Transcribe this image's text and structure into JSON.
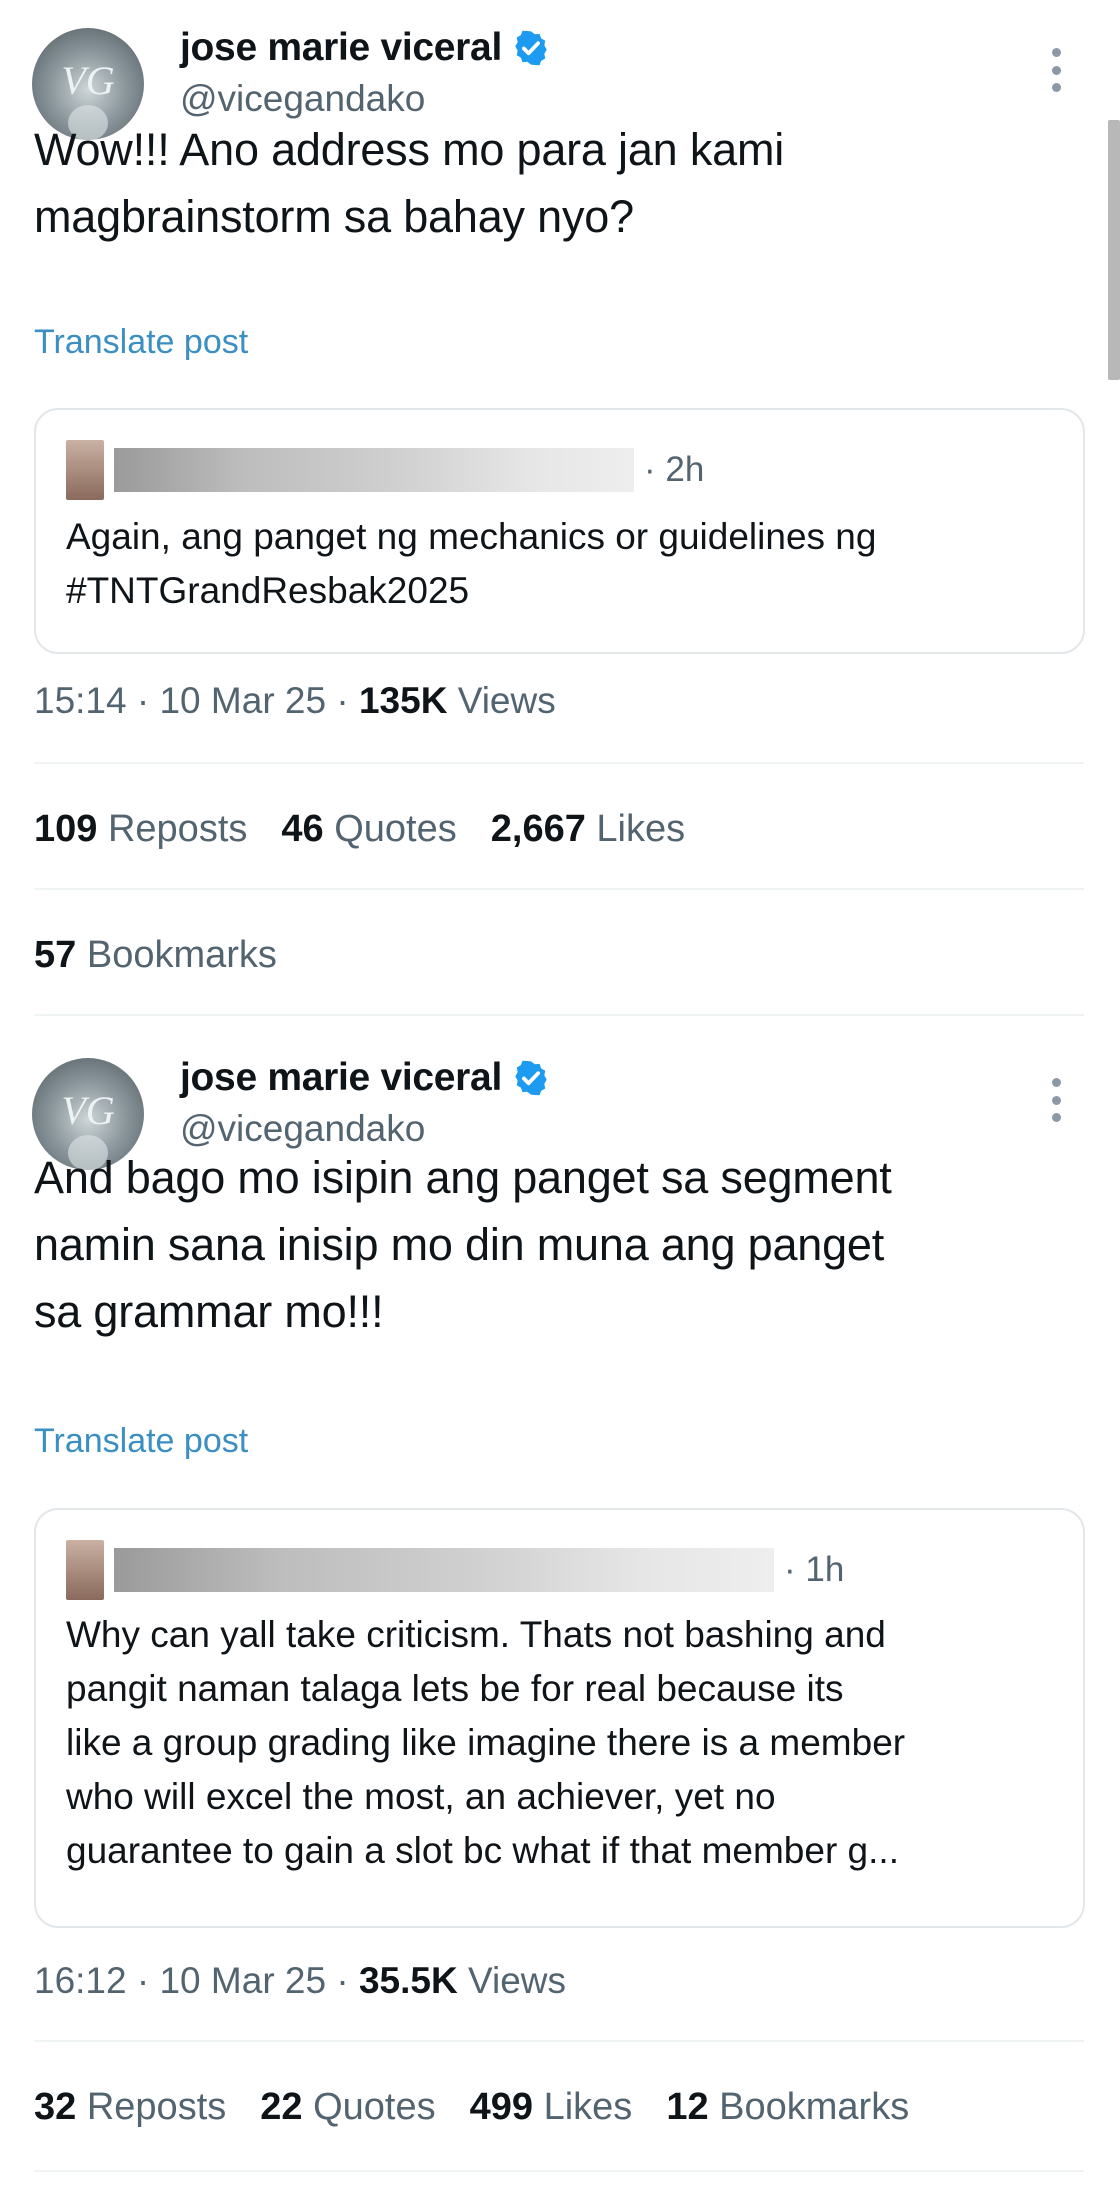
{
  "tweets": [
    {
      "display_name": "jose marie viceral",
      "handle": "@vicegandako",
      "body_lines": [
        "Wow!!! Ano address mo para jan kami",
        "magbrainstorm sa bahay nyo?"
      ],
      "translate_label": "Translate post",
      "quote": {
        "time": "· 2h",
        "text_lines": [
          "Again, ang panget ng mechanics or guidelines ng",
          "#TNTGrandResbak2025"
        ]
      },
      "meta": {
        "time": "15:14",
        "date": "10 Mar 25",
        "views_count": "135K",
        "views_label": "Views"
      },
      "stats": [
        {
          "count": "109",
          "label": "Reposts"
        },
        {
          "count": "46",
          "label": "Quotes"
        },
        {
          "count": "2,667",
          "label": "Likes"
        }
      ],
      "bookmarks": {
        "count": "57",
        "label": "Bookmarks"
      }
    },
    {
      "display_name": "jose marie viceral",
      "handle": "@vicegandako",
      "body_lines": [
        "And bago mo isipin ang panget sa segment",
        "namin sana inisip mo din muna ang panget",
        "sa grammar mo!!!"
      ],
      "translate_label": "Translate post",
      "quote": {
        "time": "· 1h",
        "text_lines": [
          "Why can yall take criticism. Thats not bashing and",
          "pangit naman talaga lets be for real because its",
          "like a group grading like imagine there is a member",
          "who will excel the most, an achiever, yet no",
          "guarantee to gain a slot bc what if that member g..."
        ]
      },
      "meta": {
        "time": "16:12",
        "date": "10 Mar 25",
        "views_count": "35.5K",
        "views_label": "Views"
      },
      "stats": [
        {
          "count": "32",
          "label": "Reposts"
        },
        {
          "count": "22",
          "label": "Quotes"
        },
        {
          "count": "499",
          "label": "Likes"
        },
        {
          "count": "12",
          "label": "Bookmarks"
        }
      ]
    }
  ],
  "colors": {
    "link": "#3b8fc2",
    "verified": "#1d9bf0",
    "secondary_text": "#536471"
  },
  "icons": {
    "verified": "verified-badge-icon",
    "more": "more-options-icon"
  }
}
